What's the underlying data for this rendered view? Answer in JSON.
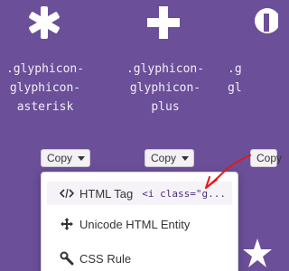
{
  "icons": [
    {
      "name": "asterisk-icon",
      "label": ".glyphicon-\nglyphicon-\nasterisk"
    },
    {
      "name": "plus-icon",
      "label": ".glyphicon-\nglyphicon-\nplus"
    },
    {
      "name": "partial-icon",
      "label": ".g\ngl"
    }
  ],
  "copy_button": {
    "label": "Copy"
  },
  "dropdown": {
    "items": [
      {
        "label": "HTML Tag",
        "code": "<i class=\"g...",
        "icon": "code-icon"
      },
      {
        "label": "Unicode HTML Entity",
        "icon": "move-icon"
      },
      {
        "label": "CSS Rule",
        "icon": "wrench-icon"
      }
    ]
  },
  "colors": {
    "background": "#6b4f99",
    "glyph": "#ffffff",
    "annotation": "#e01a1a"
  }
}
